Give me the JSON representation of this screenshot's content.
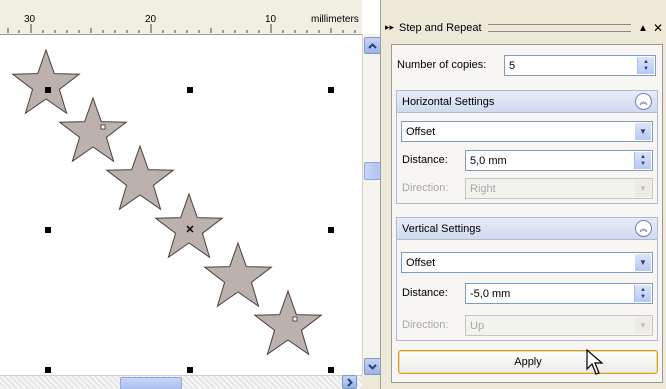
{
  "ruler": {
    "labels": [
      "30",
      "20",
      "10"
    ],
    "unit": "millimeters"
  },
  "docker": {
    "title": "Step and Repeat",
    "number_of_copies_label": "Number of copies:",
    "number_of_copies_value": "5",
    "horizontal": {
      "title": "Horizontal Settings",
      "mode": "Offset",
      "distance_label": "Distance:",
      "distance_value": "5,0 mm",
      "direction_label": "Direction:",
      "direction_value": "Right"
    },
    "vertical": {
      "title": "Vertical Settings",
      "mode": "Offset",
      "distance_label": "Distance:",
      "distance_value": "-5,0 mm",
      "direction_label": "Direction:",
      "direction_value": "Up"
    },
    "apply_label": "Apply"
  },
  "colors": {
    "star_fill": "#bcb1ac",
    "star_stroke": "#4a4240",
    "section_header": "#d1daf0",
    "apply_border": "#c6a044"
  }
}
